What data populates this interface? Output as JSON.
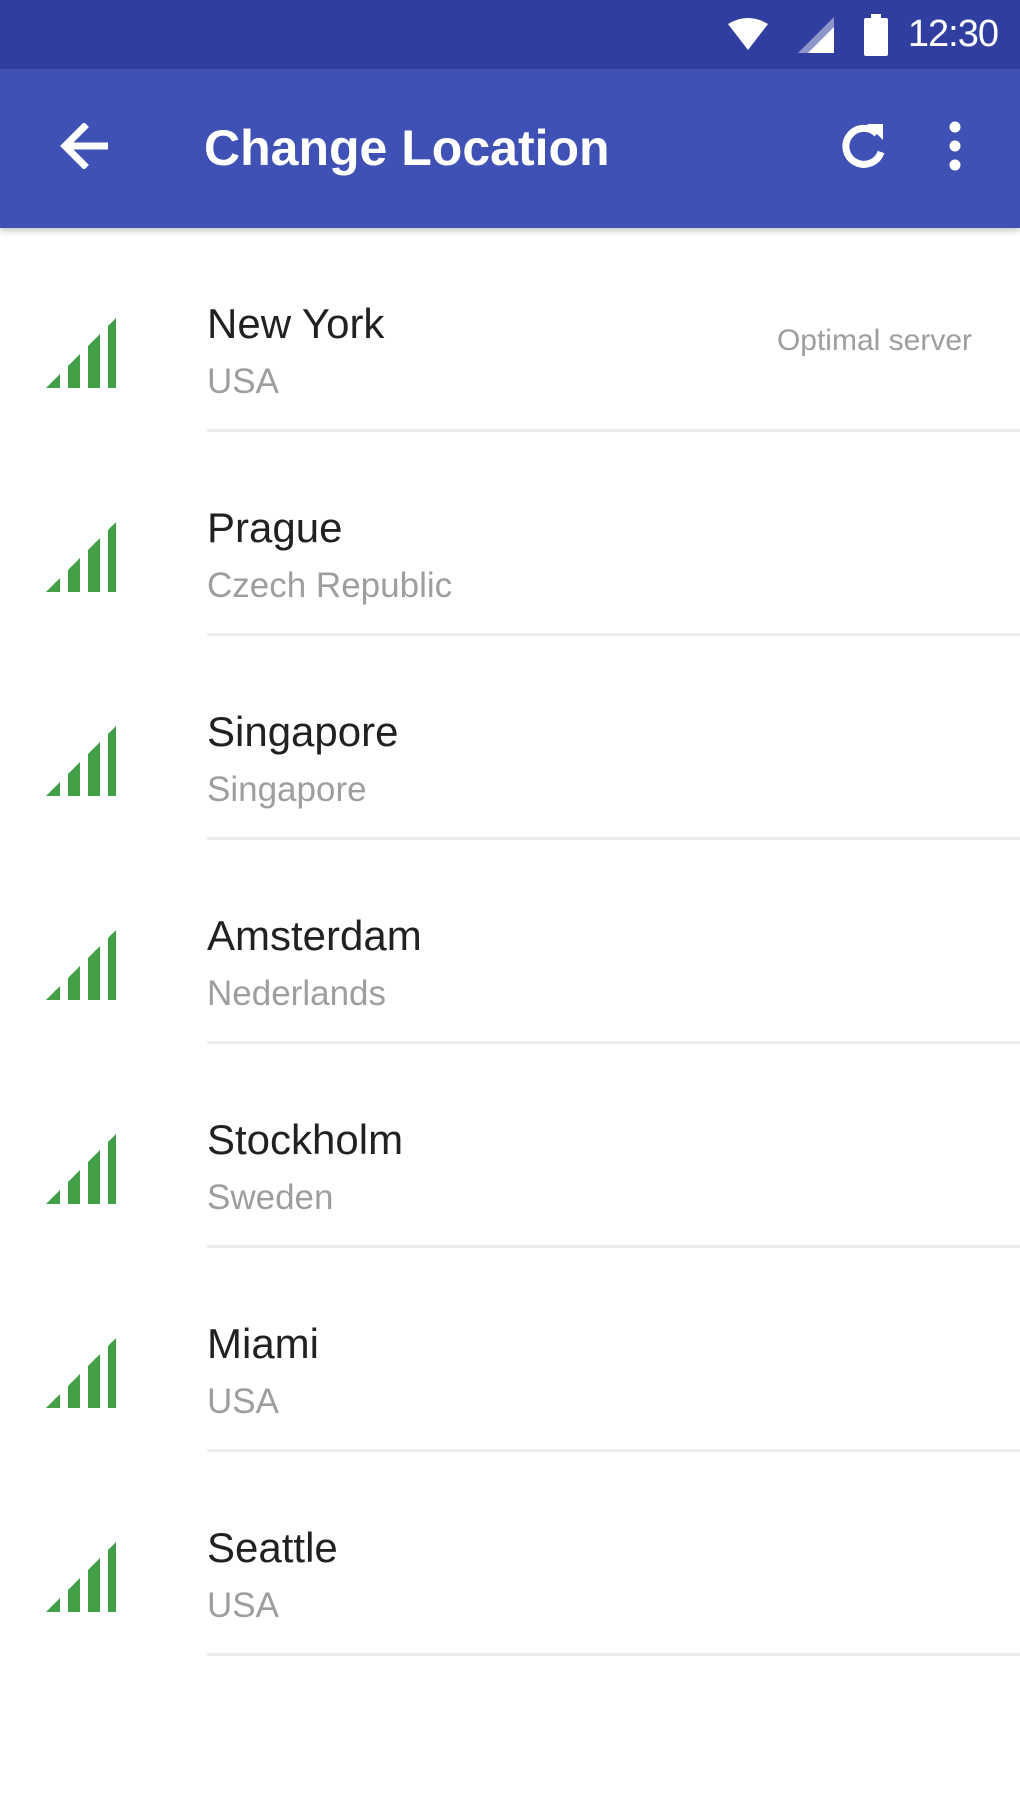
{
  "status_bar": {
    "time": "12:30",
    "icons": [
      "wifi-icon",
      "cell-signal-icon",
      "battery-icon"
    ]
  },
  "app_bar": {
    "title": "Change Location",
    "back_icon": "arrow-back-icon",
    "refresh_icon": "refresh-icon",
    "overflow_icon": "more-vert-icon"
  },
  "colors": {
    "status_bar": "#303f9f",
    "app_bar": "#3f51b5",
    "signal": "#43a047",
    "primary_text": "#212121",
    "secondary_text": "#9e9e9e"
  },
  "locations": [
    {
      "city": "New York",
      "country": "USA",
      "badge": "Optimal server",
      "signal_icon": "signal-strength-icon"
    },
    {
      "city": "Prague",
      "country": "Czech Republic",
      "badge": "",
      "signal_icon": "signal-strength-icon"
    },
    {
      "city": "Singapore",
      "country": "Singapore",
      "badge": "",
      "signal_icon": "signal-strength-icon"
    },
    {
      "city": "Amsterdam",
      "country": "Nederlands",
      "badge": "",
      "signal_icon": "signal-strength-icon"
    },
    {
      "city": "Stockholm",
      "country": "Sweden",
      "badge": "",
      "signal_icon": "signal-strength-icon"
    },
    {
      "city": "Miami",
      "country": "USA",
      "badge": "",
      "signal_icon": "signal-strength-icon"
    },
    {
      "city": "Seattle",
      "country": "USA",
      "badge": "",
      "signal_icon": "signal-strength-icon"
    }
  ]
}
